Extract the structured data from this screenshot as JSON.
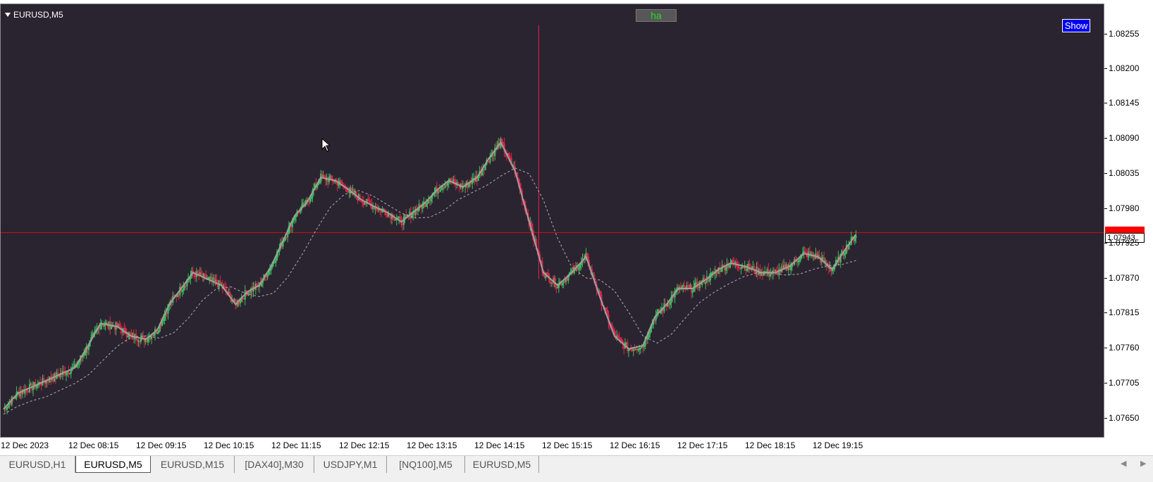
{
  "window": {
    "symbol": "EURUSD,M5",
    "ha_button": "ha",
    "show_button": "Show",
    "current_price": "1.07943"
  },
  "price_axis": {
    "labels": [
      "1.08255",
      "1.08200",
      "1.08145",
      "1.08090",
      "1.08035",
      "1.07980",
      "1.07925",
      "1.07870",
      "1.07815",
      "1.07760",
      "1.07705",
      "1.07650"
    ]
  },
  "time_axis": {
    "labels": [
      "12 Dec 2023",
      "12 Dec 08:15",
      "12 Dec 09:15",
      "12 Dec 10:15",
      "12 Dec 11:15",
      "12 Dec 12:15",
      "12 Dec 13:15",
      "12 Dec 14:15",
      "12 Dec 15:15",
      "12 Dec 16:15",
      "12 Dec 17:15",
      "12 Dec 18:15",
      "12 Dec 19:15"
    ]
  },
  "colors": {
    "background": "#2a2431",
    "bull": "#3bbd5c",
    "bear": "#e0244a",
    "fast_ma": "#a0a0a0",
    "slow_ma": "#b0b0b0",
    "price_line": "#cc1111",
    "ha_text": "#22dd22",
    "show_bg": "#0000ee"
  },
  "tabs": [
    {
      "label": "EURUSD,H1",
      "active": false
    },
    {
      "label": "EURUSD,M5",
      "active": true
    },
    {
      "label": "EURUSD,M15",
      "active": false
    },
    {
      "label": "[DAX40],M30",
      "active": false
    },
    {
      "label": "USDJPY,M1",
      "active": false
    },
    {
      "label": "[NQ100],M5",
      "active": false
    },
    {
      "label": "EURUSD,M5",
      "active": false
    }
  ],
  "chart_data": {
    "type": "candlestick",
    "symbol": "EURUSD",
    "timeframe": "M5",
    "ylim": [
      1.07625,
      1.0828
    ],
    "current_price": 1.07943,
    "close_path": [
      [
        0,
        1.07665
      ],
      [
        12,
        1.0769
      ],
      [
        24,
        1.077
      ],
      [
        36,
        1.0771
      ],
      [
        48,
        1.0772
      ],
      [
        60,
        1.0773
      ],
      [
        70,
        1.0776
      ],
      [
        82,
        1.078
      ],
      [
        96,
        1.07795
      ],
      [
        108,
        1.0778
      ],
      [
        120,
        1.07775
      ],
      [
        130,
        1.0779
      ],
      [
        140,
        1.0783
      ],
      [
        150,
        1.07855
      ],
      [
        160,
        1.0788
      ],
      [
        172,
        1.0787
      ],
      [
        184,
        1.0786
      ],
      [
        196,
        1.0783
      ],
      [
        206,
        1.0785
      ],
      [
        216,
        1.0786
      ],
      [
        226,
        1.0789
      ],
      [
        236,
        1.0793
      ],
      [
        246,
        1.0797
      ],
      [
        256,
        1.0799
      ],
      [
        268,
        1.0803
      ],
      [
        280,
        1.08025
      ],
      [
        292,
        1.0801
      ],
      [
        302,
        1.07995
      ],
      [
        312,
        1.07985
      ],
      [
        324,
        1.07975
      ],
      [
        336,
        1.0796
      ],
      [
        346,
        1.07975
      ],
      [
        356,
        1.0799
      ],
      [
        366,
        1.0801
      ],
      [
        376,
        1.08025
      ],
      [
        388,
        1.08015
      ],
      [
        400,
        1.0803
      ],
      [
        410,
        1.0806
      ],
      [
        420,
        1.08085
      ],
      [
        432,
        1.0804
      ],
      [
        444,
        1.0796
      ],
      [
        456,
        1.0788
      ],
      [
        468,
        1.0786
      ],
      [
        480,
        1.0788
      ],
      [
        492,
        1.07905
      ],
      [
        504,
        1.0784
      ],
      [
        516,
        1.0778
      ],
      [
        528,
        1.0776
      ],
      [
        540,
        1.07765
      ],
      [
        550,
        1.0781
      ],
      [
        560,
        1.0783
      ],
      [
        570,
        1.07855
      ],
      [
        582,
        1.07855
      ],
      [
        594,
        1.0787
      ],
      [
        604,
        1.07885
      ],
      [
        614,
        1.07895
      ],
      [
        626,
        1.0789
      ],
      [
        640,
        1.0788
      ],
      [
        652,
        1.0788
      ],
      [
        664,
        1.0789
      ],
      [
        676,
        1.0791
      ],
      [
        688,
        1.07905
      ],
      [
        700,
        1.07885
      ],
      [
        712,
        1.0792
      ],
      [
        720,
        1.0794
      ]
    ]
  }
}
